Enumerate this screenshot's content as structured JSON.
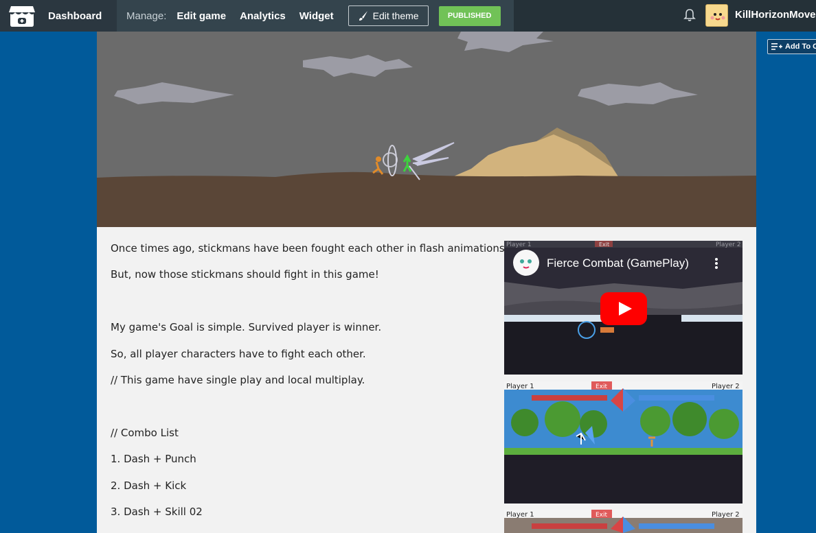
{
  "topbar": {
    "dashboard_label": "Dashboard",
    "manage_label": "Manage:",
    "nav": [
      "Edit game",
      "Analytics",
      "Widget"
    ],
    "edit_theme_label": "Edit theme",
    "published_label": "PUBLISHED",
    "username": "KillHorizonMove"
  },
  "add_to_collection_label": "Add To C",
  "description": {
    "lines": [
      "Once times ago, stickmans have been fought each other in flash animations.",
      "But, now those stickmans should fight in this game!",
      "My game's Goal is simple. Survived player is winner.",
      "So, all player characters have to fight each other.",
      "// This game have single play and local multiplay.",
      "// Combo List",
      "1.  Dash + Punch",
      "2. Dash + Kick",
      "3. Dash + Skill 02"
    ]
  },
  "video": {
    "title": "Fierce Combat (GamePlay)",
    "hud_player1": "Player 1",
    "hud_exit": "Exit",
    "hud_player2": "Player 2"
  },
  "screenshots": {
    "player1": "Player 1",
    "exit": "Exit",
    "player2": "Player 2"
  },
  "colors": {
    "topbar": "#253138",
    "manage_zone": "#34444d",
    "published": "#71c257",
    "page_bg": "#f2f2f2",
    "outer_bg": "#015a9a",
    "youtube_red": "#ff0000"
  }
}
